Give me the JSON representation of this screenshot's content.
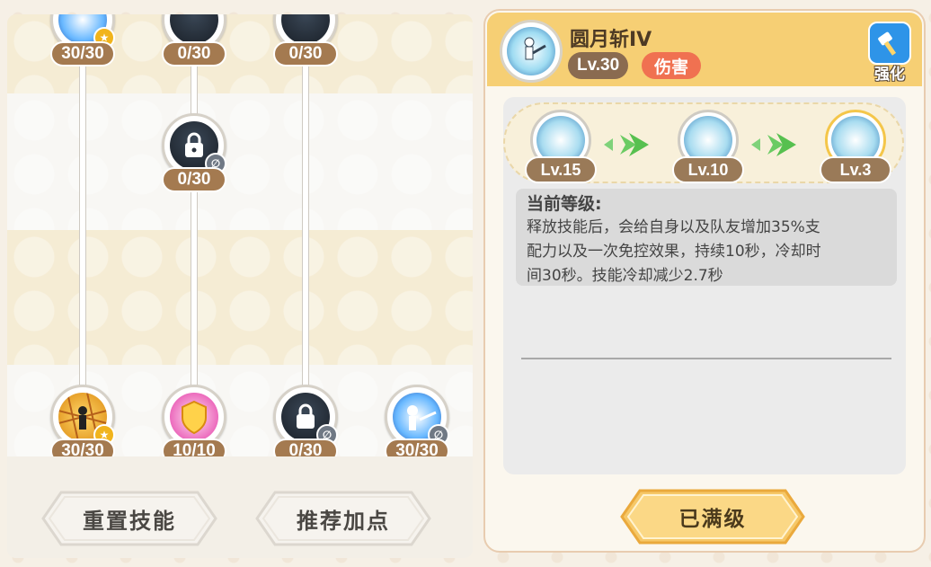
{
  "tree": {
    "nodes_row1": [
      {
        "count": "30/30",
        "icon": "skill-icon",
        "badge": "gold"
      },
      {
        "count": "0/30",
        "icon": "lock-icon",
        "badge": "none"
      },
      {
        "count": "0/30",
        "icon": "lock-icon",
        "badge": "none"
      }
    ],
    "nodes_row2": [
      {
        "count": "0/30",
        "icon": "lock-icon",
        "badge": "grey"
      }
    ],
    "nodes_row3": [
      {
        "count": "30/30",
        "icon": "net-icon",
        "badge": "gold"
      },
      {
        "count": "10/10",
        "icon": "shield-icon",
        "badge": "none"
      },
      {
        "count": "0/30",
        "icon": "lock-icon",
        "badge": "grey"
      },
      {
        "count": "30/30",
        "icon": "skill-icon",
        "badge": "grey"
      }
    ]
  },
  "buttons": {
    "reset": "重置技能",
    "recommend": "推荐加点",
    "max": "已满级"
  },
  "detail": {
    "skill_name": "圆月斩IV",
    "level": "Lv.30",
    "tag": "伤害",
    "enhance_label": "强化",
    "evolution": [
      "Lv.15",
      "Lv.10",
      "Lv.3"
    ],
    "desc_title": "当前等级:",
    "desc_lines": [
      "释放技能后，会给自身以及队友增加35%支",
      "配力以及一次免控效果，持续10秒，冷却时",
      "间30秒。技能冷却减少2.7秒"
    ]
  },
  "colors": {
    "header": "#f6cf74",
    "count_pill": "#a47a50",
    "tag": "#f07151",
    "enhance": "#2e94e8",
    "max_button": "#f6c868"
  }
}
